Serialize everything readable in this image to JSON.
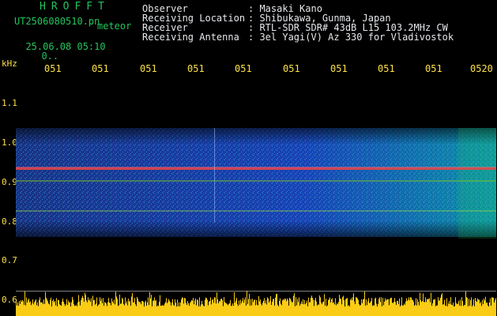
{
  "header": {
    "logo": "HROFFT",
    "filename": "UT2506080510.pn",
    "meteor_label": "meteor",
    "datetime": "25.06.08 05:10",
    "dtime_suffix": "0..",
    "observer_label": "Observer",
    "observer": "Masaki Kano",
    "location_label": "Receiving Location",
    "location": "Shibukawa, Gunma, Japan",
    "receiver_label": "Receiver",
    "receiver": "RTL-SDR SDR# 43dB L15 103.2MHz CW",
    "antenna_label": "Receiving Antenna",
    "antenna": "3el Yagi(V) Az 330 for Vladivostok"
  },
  "y_axis": {
    "unit": "kHz",
    "ticks": [
      "1.1",
      "1.0",
      "0.9",
      "0.8",
      "0.7",
      "0.6"
    ]
  },
  "x_axis": {
    "ticks": [
      "051",
      "051",
      "051",
      "051",
      "051",
      "051",
      "051",
      "051",
      "051",
      "0520"
    ]
  },
  "colors": {
    "background": "#000000",
    "text_white": "#e5e7eb",
    "text_green": "#22c55e",
    "axis_yellow": "#fde047",
    "noise_blue": "#1e3a8a",
    "signal_red": "#ef4444",
    "echo_yellow": "#facc15"
  }
}
